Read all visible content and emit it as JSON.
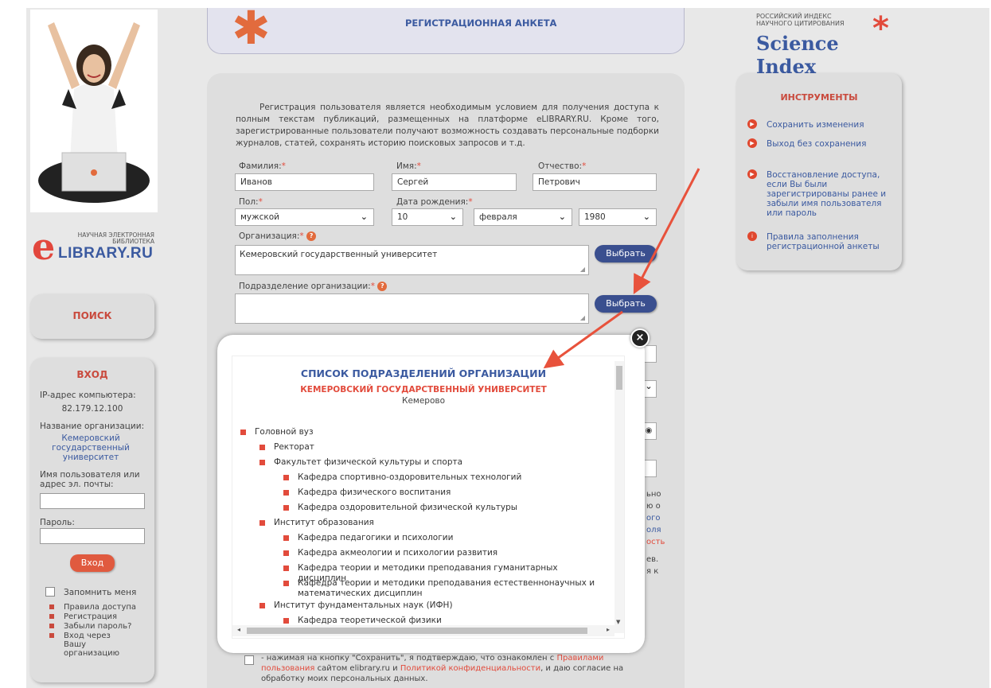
{
  "header": {
    "title": "РЕГИСТРАЦИОННАЯ АНКЕТА"
  },
  "logo": {
    "line1": "НАУЧНАЯ ЭЛЕКТРОННАЯ",
    "line2": "БИБЛИОТЕКА",
    "brand": "LIBRARY.RU"
  },
  "science_index": {
    "line1": "РОССИЙСКИЙ ИНДЕКС",
    "line2": "НАУЧНОГО ЦИТИРОВАНИЯ",
    "brand": "Science Index"
  },
  "search": {
    "label": "ПОИСК"
  },
  "login": {
    "title": "ВХОД",
    "ip_label": "IP-адрес компьютера:",
    "ip_value": "82.179.12.100",
    "org_label": "Название организации:",
    "org_value": "Кемеровский государственный университет",
    "user_label": "Имя пользователя или адрес эл. почты:",
    "password_label": "Пароль:",
    "submit": "Вход",
    "remember": "Запомнить меня",
    "links": [
      "Правила доступа",
      "Регистрация",
      "Забыли пароль?",
      "Вход через Вашу организацию"
    ]
  },
  "form": {
    "intro": "Регистрация пользователя является необходимым условием для получения доступа к полным текстам публикаций, размещенных на платформе eLIBRARY.RU. Кроме того, зарегистрированные пользователи получают возможность создавать персональные подборки журналов, статей, сохранять историю поисковых запросов и т.д.",
    "last_name_label": "Фамилия:",
    "last_name": "Иванов",
    "first_name_label": "Имя:",
    "first_name": "Сергей",
    "middle_name_label": "Отчество:",
    "middle_name": "Петрович",
    "gender_label": "Пол:",
    "gender": "мужской",
    "birth_label": "Дата рождения:",
    "birth_day": "10",
    "birth_month": "февраля",
    "birth_year": "1980",
    "org_label": "Организация:",
    "org_value": "Кемеровский государственный университет",
    "select_button": "Выбрать",
    "dept_label": "Подразделение организации:",
    "dept_value": "",
    "right_fragments": [
      "ьно",
      "ю о",
      "ого",
      "оля",
      "ость",
      "ев.",
      "я к"
    ],
    "consent_plain1": "- нажимая на кнопку \"Сохранить\", я подтверждаю, что ознакомлен с",
    "consent_link1": "Правилами пользования",
    "consent_plain2": "сайтом elibrary.ru и",
    "consent_link2": "Политикой конфиденциальности",
    "consent_plain3": ", и даю согласие на обработку моих персональных данных."
  },
  "tools": {
    "title": "ИНСТРУМЕНТЫ",
    "items": [
      "Сохранить изменения",
      "Выход без сохранения",
      "Восстановление доступа, если Вы были зарегистрированы ранее и забыли имя пользователя или пароль",
      "Правила заполнения регистрационной анкеты"
    ]
  },
  "modal": {
    "title": "СПИСОК ПОДРАЗДЕЛЕНИЙ ОРГАНИЗАЦИИ",
    "org": "КЕМЕРОВСКИЙ ГОСУДАРСТВЕННЫЙ УНИВЕРСИТЕТ",
    "city": "Кемерово",
    "tree": [
      {
        "level": 0,
        "text": "Головной вуз"
      },
      {
        "level": 1,
        "text": "Ректорат"
      },
      {
        "level": 1,
        "text": "Факультет физической культуры и спорта"
      },
      {
        "level": 2,
        "text": "Кафедра спортивно-оздоровительных технологий"
      },
      {
        "level": 2,
        "text": "Кафедра физического воспитания"
      },
      {
        "level": 2,
        "text": "Кафедра оздоровительной физической культуры"
      },
      {
        "level": 1,
        "text": "Институт образования"
      },
      {
        "level": 2,
        "text": "Кафедра педагогики и психологии"
      },
      {
        "level": 2,
        "text": "Кафедра акмеологии и психологии развития"
      },
      {
        "level": 2,
        "text": "Кафедра теории и методики преподавания гуманитарных дисциплин"
      },
      {
        "level": 2,
        "text": "Кафедра теории и методики преподавания естественнонаучных и математических дисциплин"
      },
      {
        "level": 1,
        "text": "Институт фундаментальных наук (ИФН)"
      },
      {
        "level": 2,
        "text": "Кафедра теоретической физики"
      }
    ]
  },
  "colors": {
    "accent_red": "#e24b3c",
    "brand_blue": "#3b5aa0",
    "button_blue": "#3a4f8f"
  }
}
